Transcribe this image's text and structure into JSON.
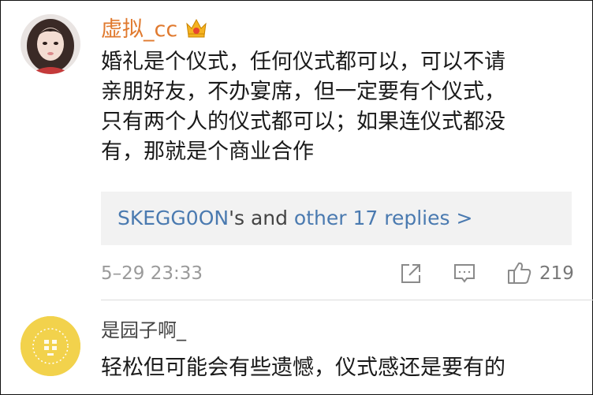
{
  "comments": [
    {
      "username": "虚拟_cc",
      "badge_icon": "crown-icon",
      "text_lines": [
        "婚礼是个仪式，任何仪式都可以，可以不请",
        "亲朋好友，不办宴席，但一定要有个仪式，",
        "只有两个人的仪式都可以；如果连仪式都没",
        "有，那就是个商业合作"
      ],
      "replies": {
        "first_replier": "SKEGG0ON",
        "connector": "'s and ",
        "more": "other 17 replies >"
      },
      "timestamp": "5–29 23:33",
      "like_count": "219",
      "actions": [
        "share-icon",
        "comment-icon",
        "thumbs-up-icon"
      ]
    },
    {
      "username": "是园子啊_",
      "text": "轻松但可能会有些遗憾，仪式感还是要有的"
    }
  ],
  "colors": {
    "username_accent": "#e07a2f",
    "link": "#4a7ab0",
    "avatar2_bg": "#f2d24c"
  }
}
